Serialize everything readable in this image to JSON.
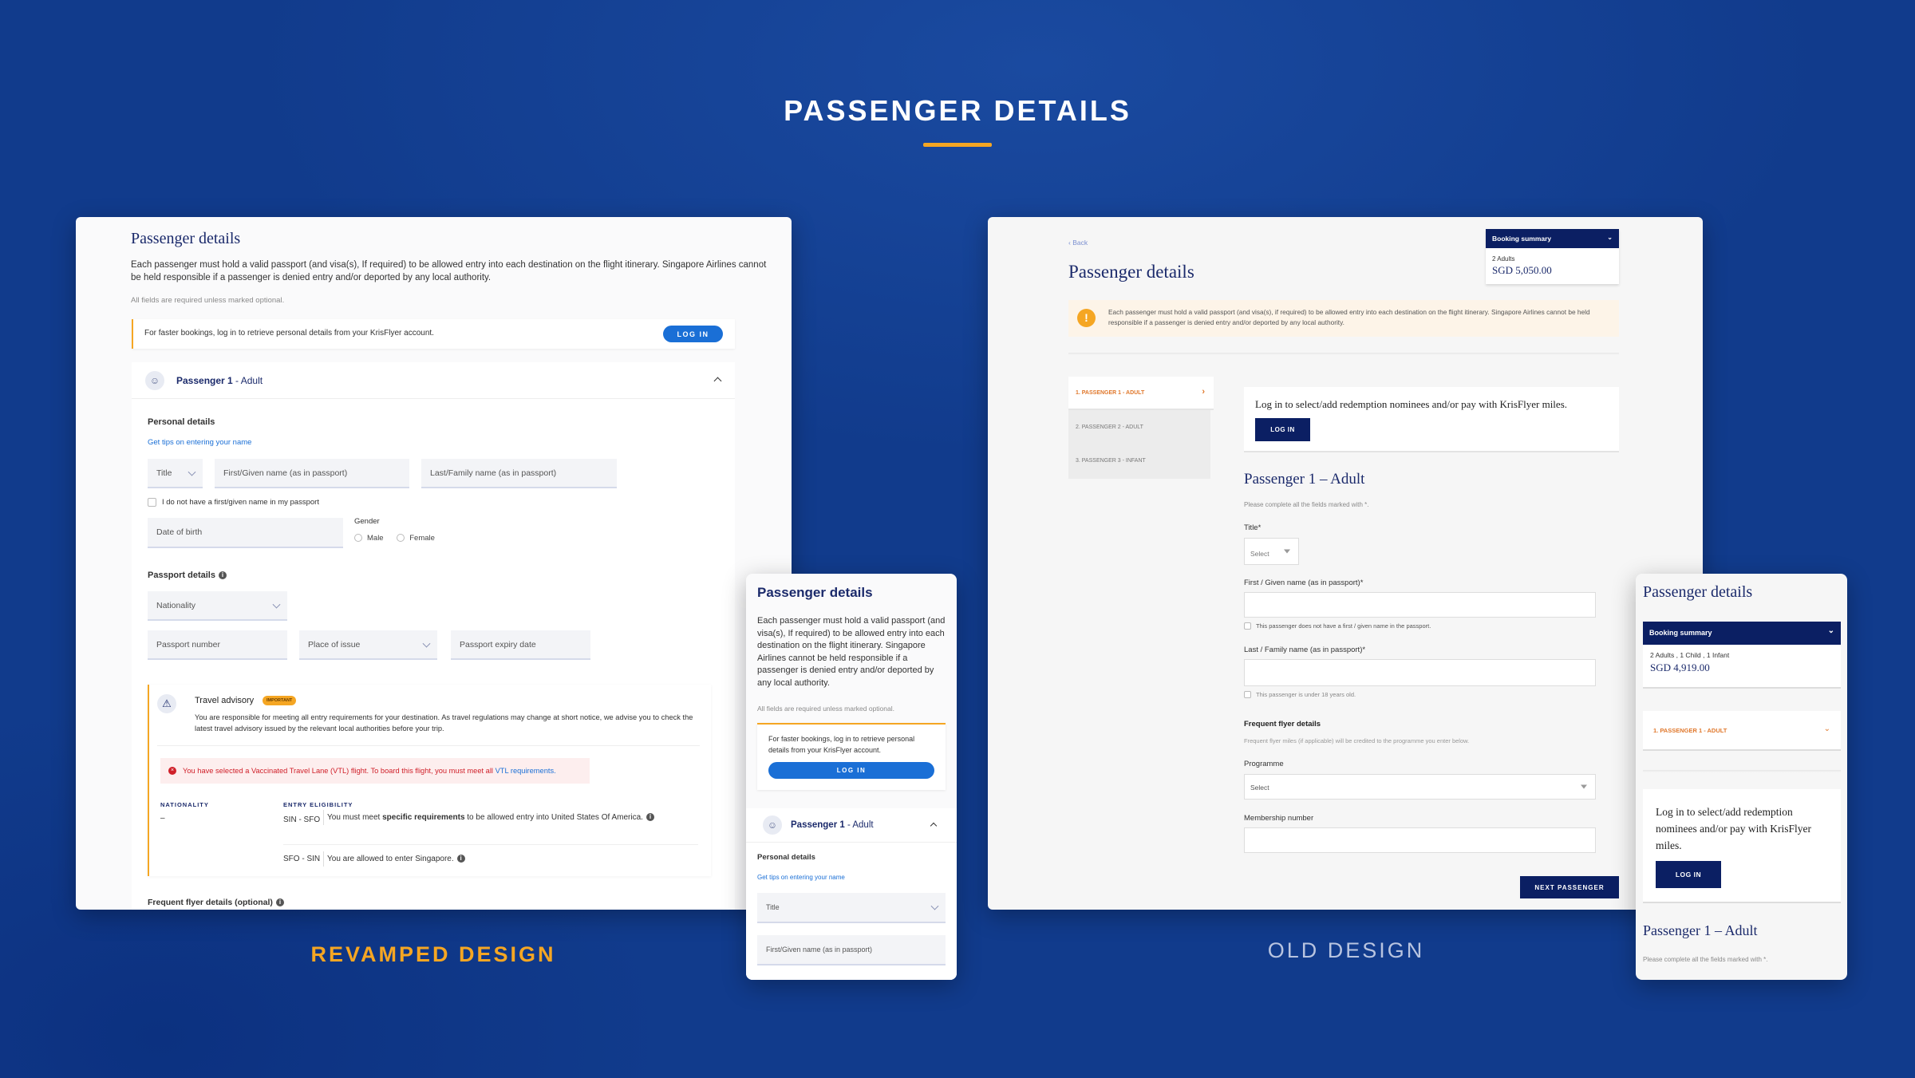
{
  "title": "PASSENGER DETAILS",
  "captions": {
    "revamped": "REVAMPED DESIGN",
    "old": "OLD DESIGN"
  },
  "colors": {
    "background": "#113b8c",
    "accent": "#f5a623",
    "navy": "#0b1f63",
    "link_blue": "#1a6fd6",
    "error_red": "#d0202a"
  },
  "revamped": {
    "heading": "Passenger details",
    "intro": "Each passenger must hold a valid passport (and visa(s), If required) to be allowed entry into each destination on the flight itinerary. Singapore Airlines cannot be held responsible if a passenger is denied entry and/or deported by any local authority.",
    "required_note": "All fields are required unless marked optional.",
    "login_banner": {
      "text": "For faster bookings, log in to retrieve personal details from your KrisFlyer account.",
      "button": "LOG IN"
    },
    "passenger": {
      "name": "Passenger 1",
      "type": " - Adult"
    },
    "personal_details": "Personal details",
    "tips_link": "Get tips on entering your name",
    "fields": {
      "title": "Title",
      "first_name": "First/Given name (as in passport)",
      "last_name": "Last/Family name (as in passport)",
      "no_first_name": "I do not have a first/given name in my passport",
      "dob": "Date of birth",
      "gender": "Gender",
      "male": "Male",
      "female": "Female"
    },
    "passport_details": "Passport details",
    "passport_fields": {
      "nationality": "Nationality",
      "number": "Passport number",
      "place": "Place of issue",
      "expiry": "Passport expiry date"
    },
    "advisory": {
      "title": "Travel advisory",
      "badge": "IMPORTANT",
      "text": "You are responsible for meeting all entry requirements for your destination. As travel regulations may change at short notice, we advise you to check the latest travel advisory issued by the relevant local authorities before your trip.",
      "error_text": "You have selected a Vaccinated Travel Lane (VTL) flight. To board this flight, you must meet all ",
      "error_link": "VTL requirements.",
      "col_nationality": "NATIONALITY",
      "col_eligibility": "ENTRY ELIGIBILITY",
      "nationality_value": "–",
      "rows": [
        {
          "route": "SIN - SFO",
          "pre": "You must meet ",
          "bold": "specific requirements",
          "post": " to be allowed entry into United States Of America."
        },
        {
          "route": "SFO - SIN",
          "pre": "You are allowed to enter Singapore.",
          "bold": "",
          "post": ""
        }
      ]
    },
    "frequent_flyer": "Frequent flyer details (optional)"
  },
  "old": {
    "back": "‹ Back",
    "heading": "Passenger details",
    "booking_summary": {
      "label": "Booking summary",
      "pax": "2 Adults",
      "price": "SGD 5,050.00"
    },
    "warning": "Each passenger must hold a valid passport (and visa(s), if required) to be allowed entry into each destination on the flight itinerary. Singapore Airlines cannot be held responsible if a passenger is denied entry and/or deported by any local authority.",
    "sidebar": [
      "1. PASSENGER 1 - ADULT",
      "2. PASSENGER 2 - ADULT",
      "3. PASSENGER 3 - INFANT"
    ],
    "login": {
      "text": "Log in to select/add redemption nominees and/or pay with KrisFlyer miles.",
      "button": "LOG IN"
    },
    "passenger_heading": "Passenger 1 – Adult",
    "required_note": "Please complete all the fields marked with *.",
    "title_label": "Title*",
    "select_placeholder": "Select",
    "first_label": "First / Given name (as in passport)*",
    "no_first_name": "This passenger does not have a first / given name in the passport.",
    "last_label": "Last / Family name (as in passport)*",
    "under_18": "This passenger is under 18 years old.",
    "ff_heading": "Frequent flyer details",
    "ff_note": "Frequent flyer miles (if applicable) will be credited to the programme you enter below.",
    "programme_label": "Programme",
    "membership_label": "Membership number",
    "next_button": "NEXT PASSENGER"
  },
  "mobile_old": {
    "heading": "Passenger details",
    "booking_summary": {
      "label": "Booking summary",
      "pax": "2 Adults , 1 Child , 1 Infant",
      "price": "SGD 4,919.00"
    },
    "passenger_row": "1. PASSENGER 1 - ADULT",
    "login_text": "Log in to select/add redemption nominees and/or pay with KrisFlyer miles.",
    "login_button": "LOG IN",
    "passenger_heading": "Passenger 1 – Adult",
    "required_note": "Please complete all the fields marked with *."
  }
}
